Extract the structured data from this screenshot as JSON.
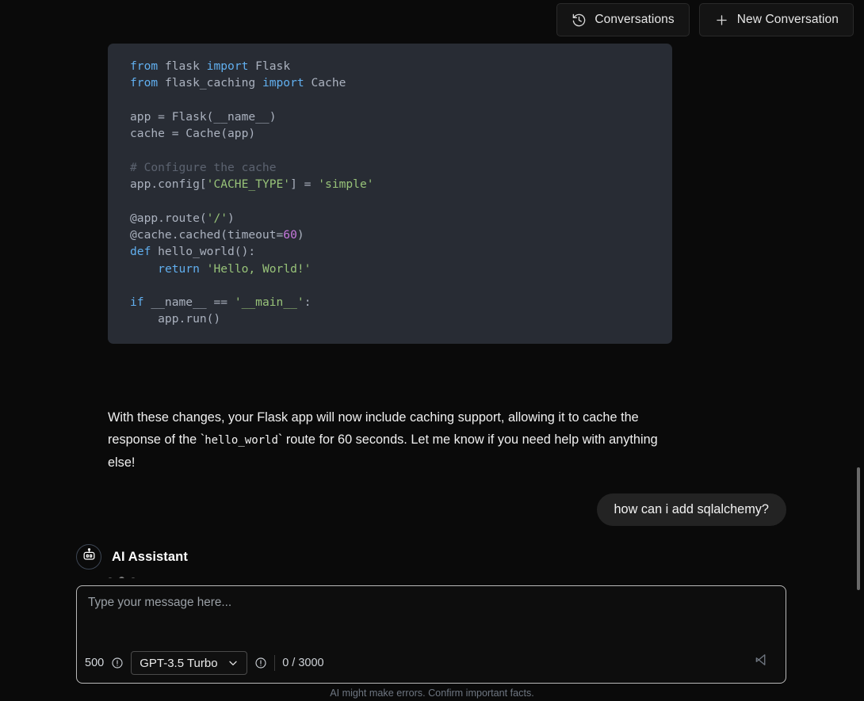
{
  "topbar": {
    "conversations_button": "Conversations",
    "new_conversation_button": "New Conversation",
    "history_icon": "history-clock-icon",
    "plus_icon": "plus-icon"
  },
  "conversation": {
    "assistant_code_block": {
      "language": "python",
      "lines": [
        "from flask import Flask",
        "from flask_caching import Cache",
        "",
        "app = Flask(__name__)",
        "cache = Cache(app)",
        "",
        "# Configure the cache",
        "app.config['CACHE_TYPE'] = 'simple'",
        "",
        "@app.route('/')",
        "@cache.cached(timeout=60)",
        "def hello_world():",
        "    return 'Hello, World!'",
        "",
        "if __name__ == '__main__':",
        "    app.run()"
      ]
    },
    "assistant_paragraph_part1": "With these changes, your Flask app will now include caching support, allowing it to cache the response of the ",
    "assistant_paragraph_code": "hello_world",
    "assistant_paragraph_part2": " route for 60 seconds. Let me know if you need help with anything else!",
    "user_message": "how can i add sqlalchemy?",
    "assistant_label": "AI Assistant",
    "assistant_avatar_icon": "robot-icon",
    "typing_indicator": "typing-dots"
  },
  "composer": {
    "placeholder": "Type your message here...",
    "value": "",
    "max_response_tokens": "500",
    "max_tokens_info_icon": "info-circle-icon",
    "selected_model": "GPT-3.5 Turbo",
    "model_options": [
      "GPT-3.5 Turbo"
    ],
    "chevron_icon": "chevron-down-icon",
    "token_info_icon": "info-circle-icon",
    "token_counter": "0 / 3000",
    "send_icon": "send-plane-icon"
  },
  "footer": {
    "disclaimer": "AI might make errors. Confirm important facts."
  },
  "colors": {
    "page_background": "#0a0a0a",
    "code_background": "#282c34",
    "code_keyword": "#61afef",
    "code_string": "#98c379",
    "code_comment": "#5c6370",
    "code_number": "#c678dd",
    "code_plain": "#abb2bf",
    "user_bubble": "#232323",
    "composer_border": "#b9b9b9"
  }
}
